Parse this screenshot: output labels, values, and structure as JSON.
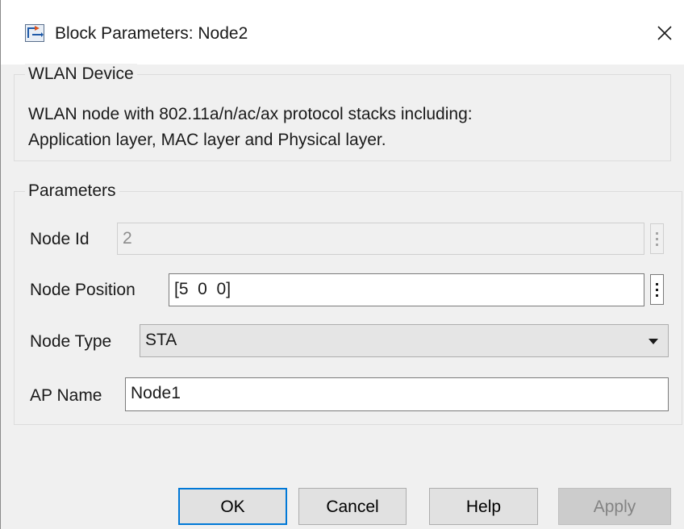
{
  "window": {
    "title": "Block Parameters: Node2",
    "app_icon": "simulink-block-icon",
    "close_icon": "close-icon"
  },
  "device_group": {
    "legend": "WLAN Device",
    "description_line1": "WLAN node with 802.11a/n/ac/ax protocol stacks including:",
    "description_line2": "Application layer, MAC layer and Physical layer."
  },
  "parameters_group": {
    "legend": "Parameters",
    "node_id": {
      "label": "Node Id",
      "value": "2",
      "enabled": false
    },
    "node_position": {
      "label": "Node Position",
      "value": "[5  0  0]"
    },
    "node_type": {
      "label": "Node Type",
      "selected": "STA"
    },
    "ap_name": {
      "label": "AP Name",
      "value": "Node1"
    }
  },
  "buttons": {
    "ok": "OK",
    "cancel": "Cancel",
    "help": "Help",
    "apply": "Apply"
  },
  "colors": {
    "default_button_border": "#0078d7",
    "dialog_background": "#f0f0f0"
  }
}
